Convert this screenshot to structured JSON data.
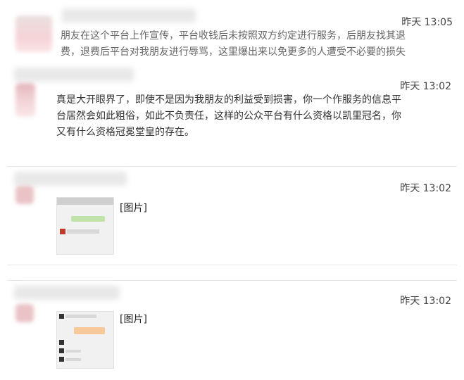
{
  "messages": [
    {
      "time": "昨天 13:05",
      "text": "朋友在这个平台上作宣传，平台收钱后未按照双方约定进行服务，后朋友找其退费，退费后平台对我朋友进行辱骂，这里爆出来以免更多的人遭受不必要的损失"
    },
    {
      "time": "昨天 13:02",
      "text": "真是大开眼界了，即使不是因为我朋友的利益受到损害，你一个作服务的信息平台居然会如此粗俗，如此不负责任，这样的公众平台有什么资格以凯里冠名，你又有什么资格冠冕堂皇的存在。"
    },
    {
      "time": "昨天 13:02",
      "image_label": "[图片]"
    },
    {
      "time": "昨天 13:02",
      "image_label": "[图片]"
    }
  ]
}
